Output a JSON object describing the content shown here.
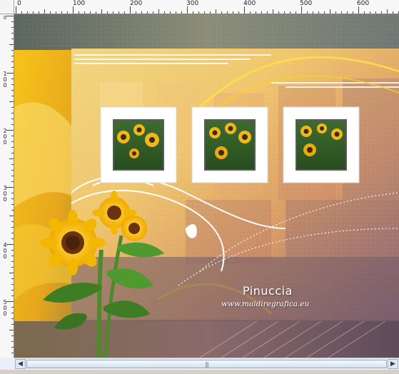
{
  "ruler": {
    "h_labels": [
      "0",
      "100",
      "200",
      "300",
      "400",
      "500",
      "600"
    ],
    "v_labels": [
      [
        "1",
        "0",
        "0"
      ],
      [
        "2",
        "0",
        "0"
      ],
      [
        "3",
        "0",
        "0"
      ],
      [
        "4",
        "0",
        "0"
      ],
      [
        "5",
        "0",
        "0"
      ]
    ]
  },
  "artwork": {
    "signature": "Pinuccia",
    "website": "www.maidiregrafica.eu"
  },
  "scrollbar": {
    "left_arrow": "◀",
    "right_arrow": "▶",
    "grip": "|||"
  }
}
